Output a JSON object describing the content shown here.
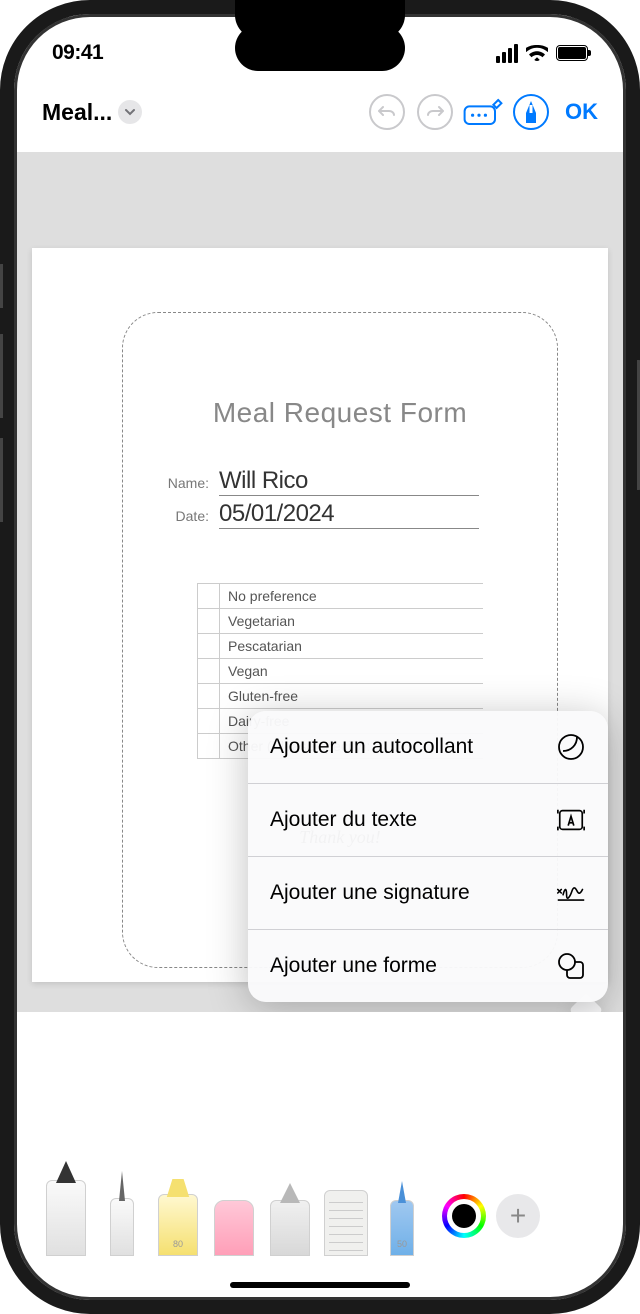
{
  "status": {
    "time": "09:41"
  },
  "toolbar": {
    "title": "Meal...",
    "ok": "OK"
  },
  "document": {
    "title": "Meal Request Form",
    "name_label": "Name:",
    "name_value": "Will Rico",
    "date_label": "Date:",
    "date_value": "05/01/2024",
    "options": [
      "No preference",
      "Vegetarian",
      "Pescatarian",
      "Vegan",
      "Gluten-free",
      "Dairy-free",
      "Other (Please specify):"
    ],
    "thank_you": "Thank you!"
  },
  "menu": {
    "items": [
      "Ajouter un autocollant",
      "Ajouter du texte",
      "Ajouter une signature",
      "Ajouter une forme"
    ]
  },
  "tools": {
    "marker_value": "80",
    "blue_value": "50"
  }
}
